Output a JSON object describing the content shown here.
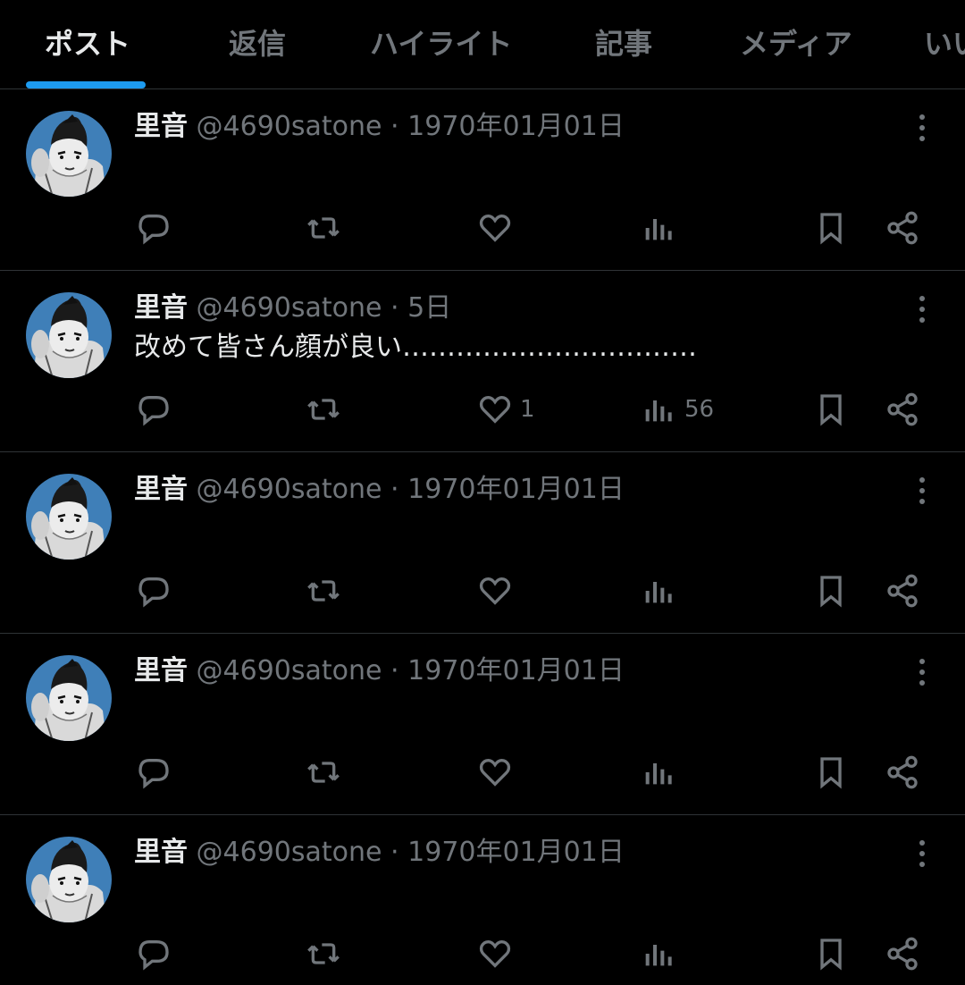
{
  "tabs": [
    {
      "label": "ポスト",
      "active": true
    },
    {
      "label": "返信",
      "active": false
    },
    {
      "label": "ハイライト",
      "active": false
    },
    {
      "label": "記事",
      "active": false
    },
    {
      "label": "メディア",
      "active": false
    },
    {
      "label": "いいね",
      "active": false
    }
  ],
  "posts": [
    {
      "name": "里音",
      "handle": "@4690satone",
      "sep": "·",
      "date": "1970年01月01日",
      "text": "",
      "likes": "",
      "views": ""
    },
    {
      "name": "里音",
      "handle": "@4690satone",
      "sep": "·",
      "date": "5日",
      "text": "改めて皆さん顔が良い……………………………",
      "likes": "1",
      "views": "56"
    },
    {
      "name": "里音",
      "handle": "@4690satone",
      "sep": "·",
      "date": "1970年01月01日",
      "text": "",
      "likes": "",
      "views": ""
    },
    {
      "name": "里音",
      "handle": "@4690satone",
      "sep": "·",
      "date": "1970年01月01日",
      "text": "",
      "likes": "",
      "views": ""
    },
    {
      "name": "里音",
      "handle": "@4690satone",
      "sep": "·",
      "date": "1970年01月01日",
      "text": "",
      "likes": "",
      "views": ""
    }
  ],
  "icons": {
    "reply": "reply-icon",
    "repost": "repost-icon",
    "like": "like-icon",
    "views": "views-icon",
    "bookmark": "bookmark-icon",
    "share": "share-icon",
    "more": "more-icon"
  },
  "colors": {
    "background": "#000000",
    "accent": "#1d9bf0",
    "text": "#e7e9ea",
    "muted": "#71767b",
    "divider": "#2f3336"
  }
}
